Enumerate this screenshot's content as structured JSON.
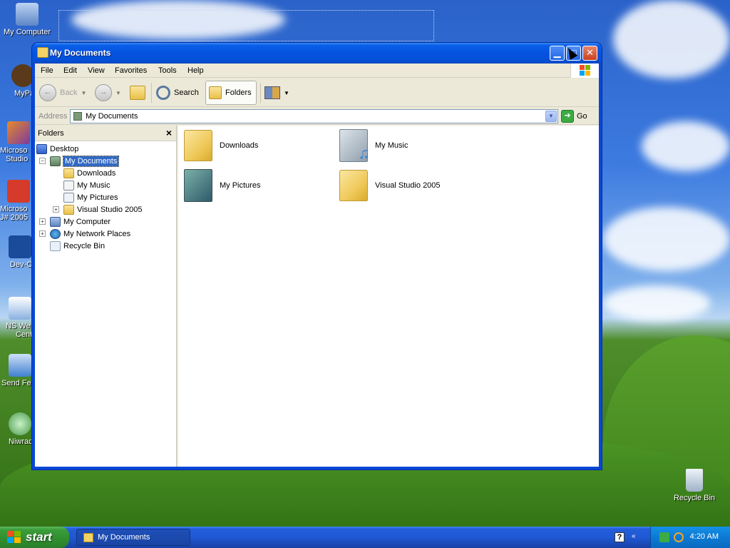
{
  "desktop": {
    "icons": [
      {
        "label": "My Computer",
        "icon": "my-computer-icon"
      },
      {
        "label": "MyPa",
        "icon": "mypal-icon"
      },
      {
        "label": "Microso",
        "label2": "Studio",
        "icon": "visual-studio-icon"
      },
      {
        "label": "Microso",
        "label2": "J# 2005",
        "icon": "vj-sharp-icon"
      },
      {
        "label": "Dev-C",
        "icon": "dev-cpp-icon"
      },
      {
        "label": "NS We",
        "label2": "Cent",
        "icon": "ns-welcome-icon"
      },
      {
        "label": "Send Fe",
        "icon": "send-feedback-icon"
      },
      {
        "label": "Niwrac",
        "icon": "alien-icon"
      },
      {
        "label": "Recycle Bin",
        "icon": "recycle-bin-icon"
      }
    ]
  },
  "window": {
    "title": "My Documents",
    "menu": [
      "File",
      "Edit",
      "View",
      "Favorites",
      "Tools",
      "Help"
    ],
    "toolbar": {
      "back": "Back",
      "search": "Search",
      "folders": "Folders"
    },
    "address": {
      "label": "Address",
      "value": "My Documents",
      "go": "Go"
    },
    "folders_pane": {
      "title": "Folders",
      "close": "×",
      "tree": [
        {
          "label": "Desktop",
          "icon": "desktop-icon",
          "level": 0
        },
        {
          "label": "My Documents",
          "icon": "my-documents-icon",
          "level": 1,
          "expander": "−",
          "selected": true
        },
        {
          "label": "Downloads",
          "icon": "folder-icon",
          "level": 2
        },
        {
          "label": "My Music",
          "icon": "my-music-icon",
          "level": 2
        },
        {
          "label": "My Pictures",
          "icon": "my-pictures-icon",
          "level": 2
        },
        {
          "label": "Visual Studio 2005",
          "icon": "folder-icon",
          "level": 2,
          "expander": "+"
        },
        {
          "label": "My Computer",
          "icon": "my-computer-icon",
          "level": 1,
          "expander": "+"
        },
        {
          "label": "My Network Places",
          "icon": "network-places-icon",
          "level": 1,
          "expander": "+"
        },
        {
          "label": "Recycle Bin",
          "icon": "recycle-bin-icon",
          "level": 1
        }
      ]
    },
    "items": [
      {
        "label": "Downloads",
        "icon": "folder-icon"
      },
      {
        "label": "My Music",
        "icon": "my-music-icon"
      },
      {
        "label": "My Pictures",
        "icon": "my-pictures-icon"
      },
      {
        "label": "Visual Studio 2005",
        "icon": "folder-icon"
      }
    ]
  },
  "taskbar": {
    "start": "start",
    "task": "My Documents",
    "help": "?",
    "chevron": "«",
    "clock": "4:20 AM"
  }
}
